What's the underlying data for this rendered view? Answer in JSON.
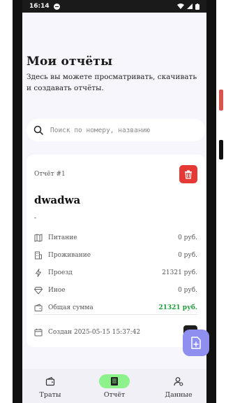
{
  "status": {
    "time": "16:14"
  },
  "header": {
    "title": "Мои отчёты",
    "subtitle": "Здесь вы можете просматривать, скачивать и создавать отчёты."
  },
  "search": {
    "placeholder": "Поиск по номеру, названию"
  },
  "report": {
    "label": "Отчёт #1",
    "title": "dwadwa",
    "description": "-",
    "rows": [
      {
        "icon": "map-icon",
        "label": "Питание",
        "value": "0 руб."
      },
      {
        "icon": "building-icon",
        "label": "Проживание",
        "value": "0 руб."
      },
      {
        "icon": "lightning-icon",
        "label": "Проезд",
        "value": "21321 руб."
      },
      {
        "icon": "diamond-icon",
        "label": "Иное",
        "value": "0 руб."
      },
      {
        "icon": "wallet-icon",
        "label": "Общая сумма",
        "value": "21321 руб."
      }
    ],
    "created": "Создан 2025-05-15 15:37:42"
  },
  "nav": {
    "items": [
      {
        "label": "Траты",
        "icon": "wallet-icon"
      },
      {
        "label": "Отчёт",
        "icon": "report-icon"
      },
      {
        "label": "Данные",
        "icon": "user-settings-icon"
      }
    ],
    "active": 1
  },
  "colors": {
    "accent_fab": "#8f8ff0",
    "delete": "#e53935",
    "total_green": "#1f9d3a",
    "nav_active": "#8ef28c"
  }
}
